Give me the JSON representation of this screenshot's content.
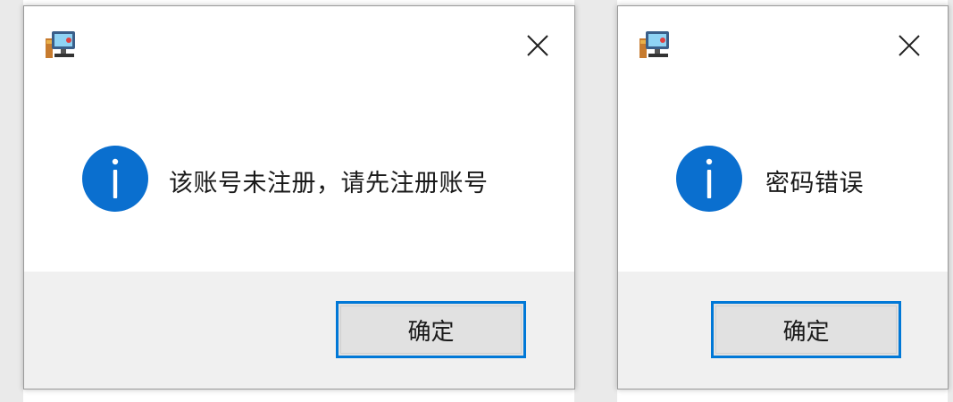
{
  "dialogs": [
    {
      "app_icon": "app-computer-icon",
      "close_icon": "close-icon",
      "info_icon": "information-icon",
      "message": "该账号未注册，请先注册账号",
      "ok_label": "确定"
    },
    {
      "app_icon": "app-computer-icon",
      "close_icon": "close-icon",
      "info_icon": "information-icon",
      "message": "密码错误",
      "ok_label": "确定"
    }
  ],
  "colors": {
    "accent": "#0078d7",
    "info_circle": "#0a6fcf",
    "footer_bg": "#f0f0f0",
    "button_bg": "#e1e1e1"
  }
}
